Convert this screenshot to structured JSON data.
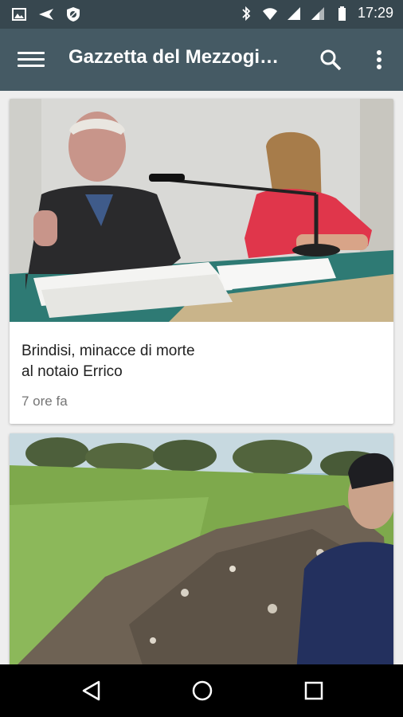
{
  "status_bar": {
    "time": "17:29",
    "left_icons": [
      "image-icon",
      "send-icon",
      "shield-icon"
    ],
    "right_icons": [
      "bluetooth-icon",
      "wifi-icon",
      "signal-icon",
      "signal-icon",
      "battery-icon"
    ]
  },
  "app_bar": {
    "title": "Gazzetta del Mezzogi…",
    "icons": [
      "menu-icon",
      "search-icon",
      "more-vert-icon"
    ]
  },
  "articles": [
    {
      "headline_line1": "Brindisi, minacce di morte",
      "headline_line2": "al notaio Errico",
      "time": "7 ore fa"
    }
  ],
  "nav_bar": {
    "icons": [
      "back-icon",
      "home-icon",
      "recents-icon"
    ]
  },
  "colors": {
    "status_bar": "#37474f",
    "app_bar": "#455a64",
    "background": "#eeeeee"
  }
}
